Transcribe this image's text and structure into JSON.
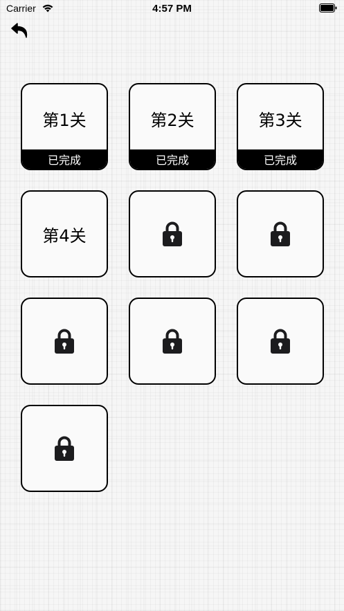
{
  "status_bar": {
    "carrier": "Carrier",
    "time": "4:57 PM",
    "icons": [
      "wifi-icon",
      "battery-icon"
    ]
  },
  "nav": {
    "back_icon": "back-arrow-icon"
  },
  "levels": [
    {
      "title": "第1关",
      "status": "已完成",
      "locked": false
    },
    {
      "title": "第2关",
      "status": "已完成",
      "locked": false
    },
    {
      "title": "第3关",
      "status": "已完成",
      "locked": false
    },
    {
      "title": "第4关",
      "locked": false
    },
    {
      "locked": true,
      "icon": "lock-icon"
    },
    {
      "locked": true,
      "icon": "lock-icon"
    },
    {
      "locked": true,
      "icon": "lock-icon"
    },
    {
      "locked": true,
      "icon": "lock-icon"
    },
    {
      "locked": true,
      "icon": "lock-icon"
    }
  ],
  "colors": {
    "card_border": "#000000",
    "completed_band": "#000000",
    "completed_text": "#ffffff",
    "lock_icon": "#1c1c1e"
  }
}
